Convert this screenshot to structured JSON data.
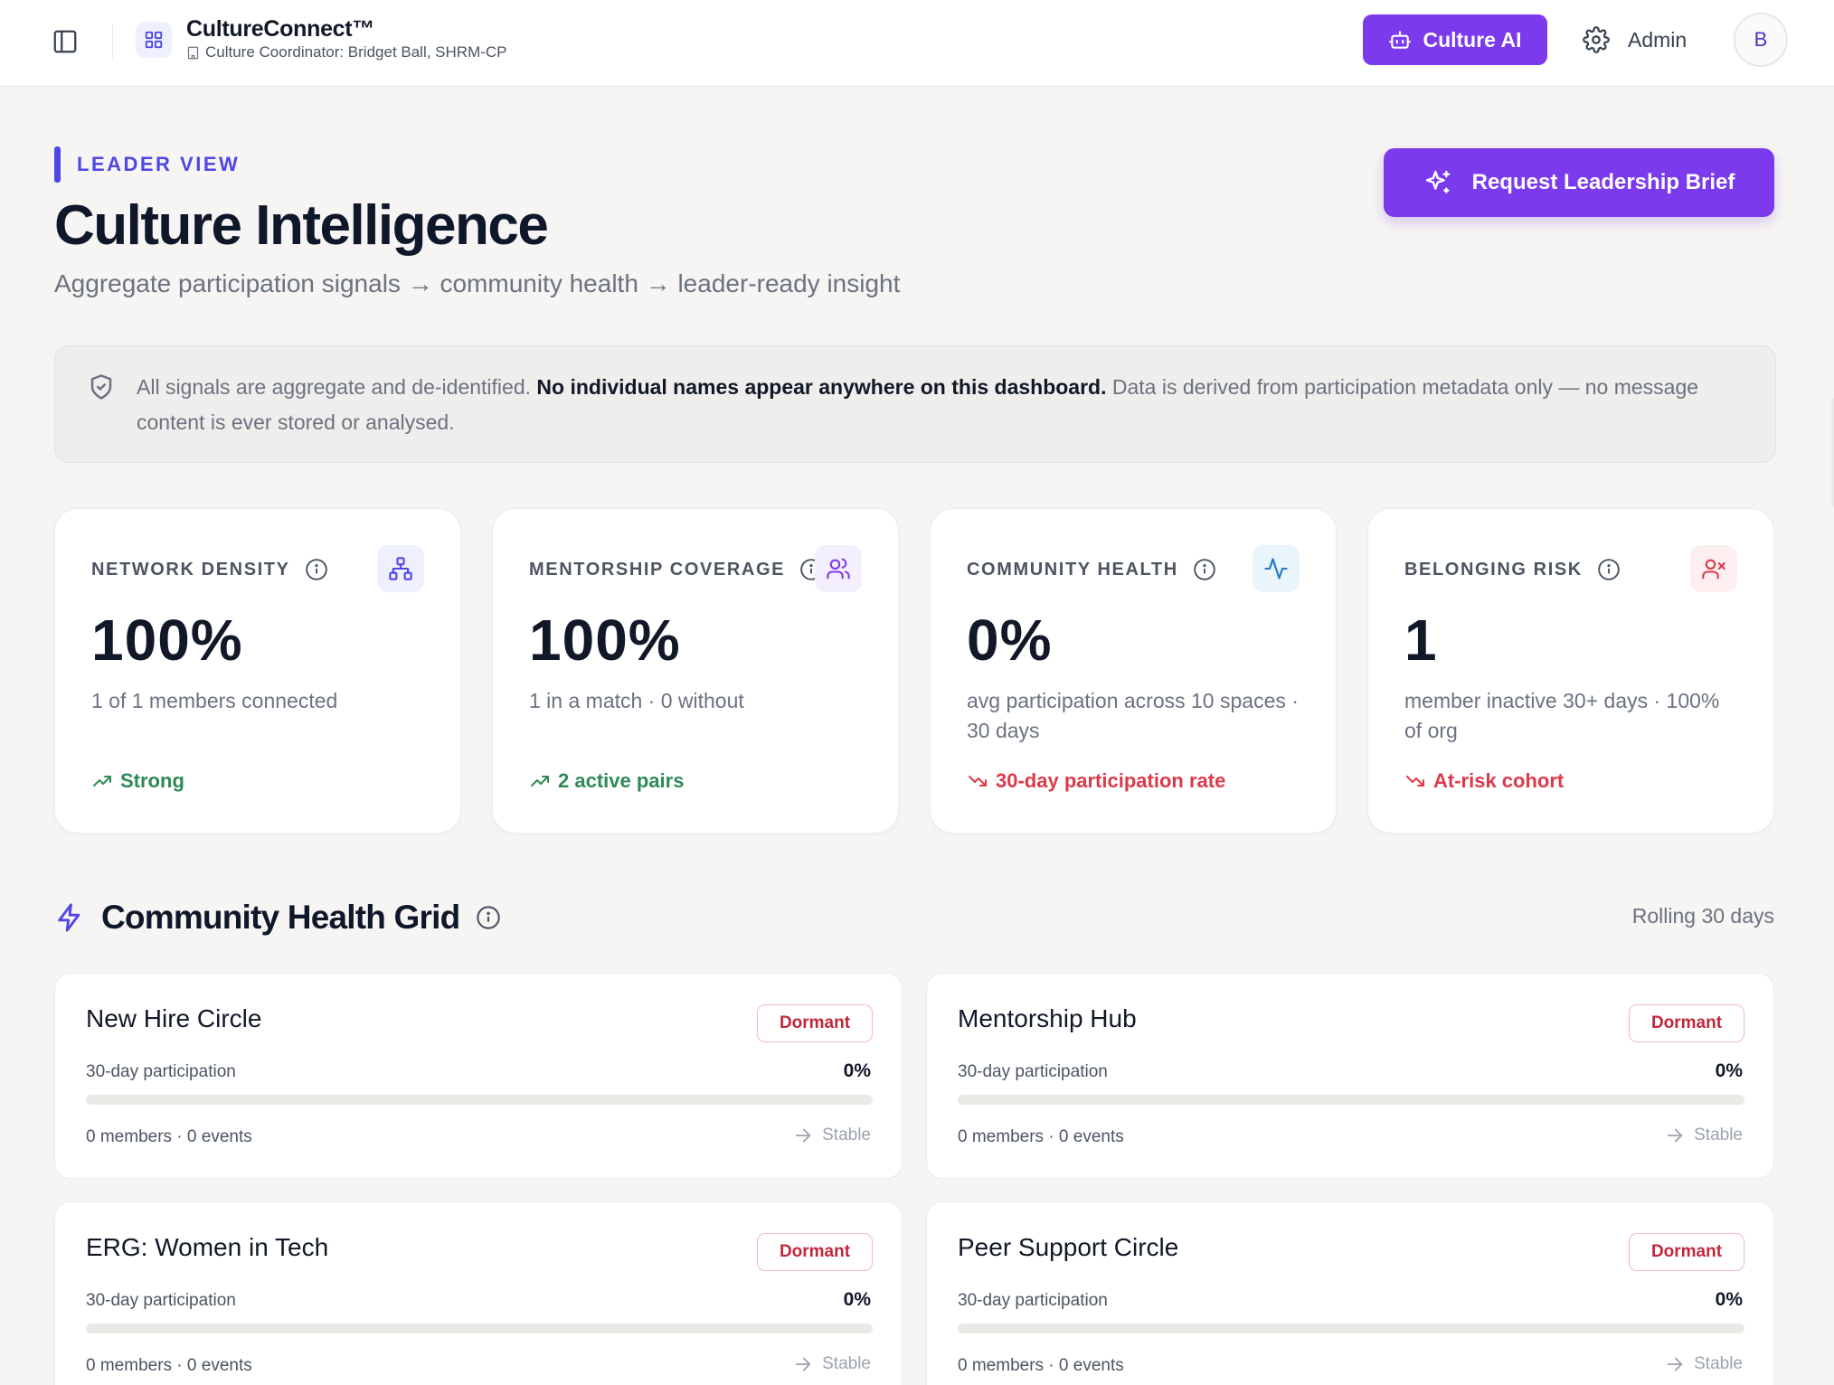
{
  "header": {
    "brand": "CultureConnect™",
    "coordinator": "Culture Coordinator: Bridget Ball, SHRM-CP",
    "ai_button": "Culture AI",
    "admin_label": "Admin",
    "avatar_initial": "B"
  },
  "page": {
    "eyebrow": "LEADER VIEW",
    "title": "Culture Intelligence",
    "subtitle": "Aggregate participation signals → community health → leader-ready insight",
    "brief_button": "Request Leadership Brief"
  },
  "notice": {
    "lead": "All signals are aggregate and de-identified.",
    "bold": "No individual names appear anywhere on this dashboard.",
    "tail": "Data is derived from participation metadata only — no message content is ever stored or analysed."
  },
  "kpis": [
    {
      "label": "NETWORK DENSITY",
      "value": "100%",
      "desc": "1 of 1 members connected",
      "trend": "Strong",
      "trend_dir": "up",
      "icon": "org-chart-icon",
      "tile_color": "#eef0fd",
      "icon_color": "#4f46e5"
    },
    {
      "label": "MENTORSHIP COVERAGE",
      "value": "100%",
      "desc": "1 in a match · 0 without",
      "trend": "2 active pairs",
      "trend_dir": "up",
      "icon": "users-icon",
      "tile_color": "#f3effe",
      "icon_color": "#7c3aed"
    },
    {
      "label": "COMMUNITY HEALTH",
      "value": "0%",
      "desc": "avg participation across 10 spaces · 30 days",
      "trend": "30-day participation rate",
      "trend_dir": "down",
      "icon": "activity-icon",
      "tile_color": "#eaf4fb",
      "icon_color": "#1f78c8"
    },
    {
      "label": "BELONGING RISK",
      "value": "1",
      "desc": "member inactive 30+ days · 100% of org",
      "trend": "At-risk cohort",
      "trend_dir": "down",
      "icon": "user-x-icon",
      "tile_color": "#fdeef0",
      "icon_color": "#dc3a4a"
    }
  ],
  "section": {
    "title": "Community Health Grid",
    "right_label": "Rolling 30 days",
    "participation_label": "30-day participation"
  },
  "communities": [
    {
      "name": "New Hire Circle",
      "status": "Dormant",
      "participation_text": "0%",
      "participation": 0,
      "meta": "0 members · 0 events",
      "trend": "Stable"
    },
    {
      "name": "Mentorship Hub",
      "status": "Dormant",
      "participation_text": "0%",
      "participation": 0,
      "meta": "0 members · 0 events",
      "trend": "Stable"
    },
    {
      "name": "ERG: Women in Tech",
      "status": "Dormant",
      "participation_text": "0%",
      "participation": 0,
      "meta": "0 members · 0 events",
      "trend": "Stable"
    },
    {
      "name": "Peer Support Circle",
      "status": "Dormant",
      "participation_text": "0%",
      "participation": 0,
      "meta": "0 members · 0 events",
      "trend": "Stable"
    }
  ],
  "colors": {
    "accent": "#7c3aed",
    "indigo": "#4f46e5",
    "good": "#2f8a58",
    "bad": "#dc3a4a"
  }
}
